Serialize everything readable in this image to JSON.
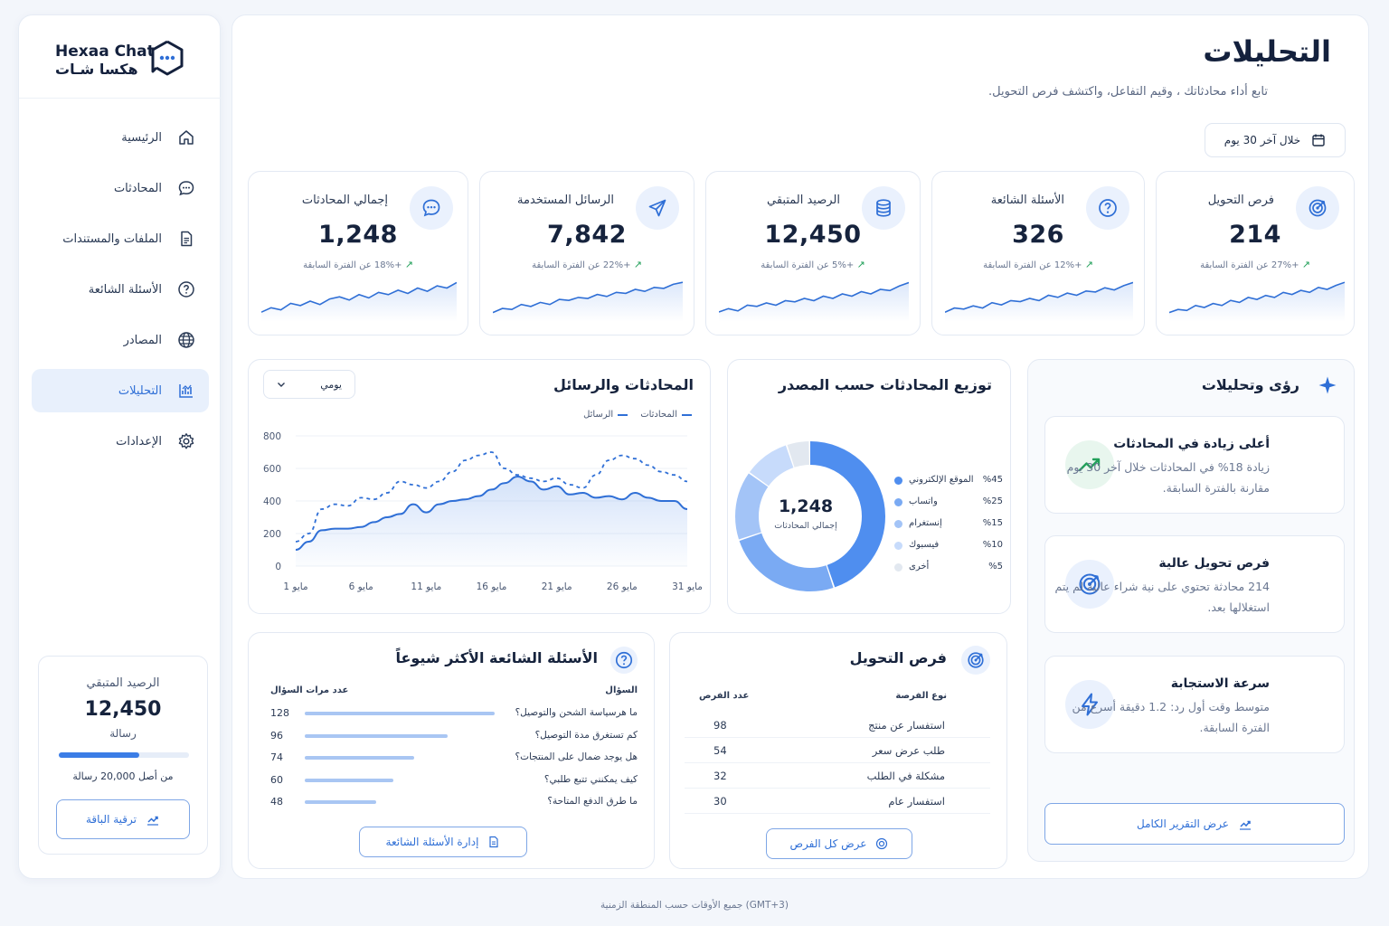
{
  "brand": {
    "name_en": "Hexaa Chat",
    "name_ar": "هكسا شـات"
  },
  "sidebar": {
    "items": [
      {
        "label": "الرئيسية",
        "icon": "home-icon"
      },
      {
        "label": "المحادثات",
        "icon": "chat-icon"
      },
      {
        "label": "الملفات والمستندات",
        "icon": "file-icon"
      },
      {
        "label": "الأسئلة الشائعة",
        "icon": "question-icon"
      },
      {
        "label": "المصادر",
        "icon": "globe-icon"
      },
      {
        "label": "التحليلات",
        "icon": "chart-icon",
        "active": true
      },
      {
        "label": "الإعدادات",
        "icon": "gear-icon"
      }
    ],
    "balance": {
      "title": "الرصيد المتبقي",
      "value": "12,450",
      "unit": "رسالة",
      "progress": 0.62,
      "of_text": "من أصل 20,000 رسالة",
      "upgrade_label": "ترقية الباقة"
    }
  },
  "header": {
    "title": "التحليلات",
    "subtitle": "تابع أداء محادثاتك ، وقيم التفاعل، واكتشف فرص التحويل.",
    "date_filter": "خلال آخر 30 يوم"
  },
  "kpis": [
    {
      "title": "إجمالي المحادثات",
      "value": "1,248",
      "change": "+18%",
      "suffix": "عن الفترة السابقة",
      "icon": "chat-bubble-icon",
      "spark": [
        30,
        34,
        32,
        38,
        36,
        40,
        37,
        42,
        44,
        41,
        46,
        43,
        48,
        46,
        50,
        47,
        52,
        49,
        54,
        52,
        57
      ]
    },
    {
      "title": "الرسائل المستخدمة",
      "value": "7,842",
      "change": "+22%",
      "suffix": "عن الفترة السابقة",
      "icon": "send-icon",
      "spark": [
        28,
        32,
        31,
        36,
        34,
        38,
        36,
        41,
        40,
        43,
        42,
        46,
        44,
        48,
        47,
        51,
        49,
        53,
        52,
        56,
        58
      ]
    },
    {
      "title": "الرصيد المتبقي",
      "value": "12,450",
      "change": "+5%",
      "suffix": "عن الفترة السابقة",
      "icon": "database-icon",
      "spark": [
        30,
        33,
        31,
        36,
        35,
        38,
        36,
        40,
        39,
        42,
        40,
        44,
        42,
        46,
        44,
        48,
        46,
        50,
        49,
        53,
        56
      ]
    },
    {
      "title": "الأسئلة الشائعة",
      "value": "326",
      "change": "+12%",
      "suffix": "عن الفترة السابقة",
      "icon": "question-circle-icon",
      "spark": [
        29,
        33,
        32,
        35,
        33,
        38,
        36,
        40,
        39,
        42,
        40,
        45,
        43,
        47,
        45,
        49,
        48,
        52,
        50,
        54,
        57
      ]
    },
    {
      "title": "فرص التحويل",
      "value": "214",
      "change": "+27%",
      "suffix": "عن الفترة السابقة",
      "icon": "target-icon",
      "spark": [
        28,
        31,
        30,
        35,
        33,
        37,
        35,
        40,
        38,
        43,
        41,
        45,
        43,
        48,
        46,
        50,
        48,
        53,
        51,
        55,
        58
      ]
    }
  ],
  "line_chart": {
    "title": "المحادثات والرسائل",
    "period": "يومي",
    "chart_data": {
      "type": "line",
      "x": [
        "1 مايو",
        "6 مايو",
        "11 مايو",
        "16 مايو",
        "21 مايو",
        "26 مايو",
        "31 مايو"
      ],
      "ylim": [
        0,
        800
      ],
      "yticks": [
        0,
        200,
        400,
        600,
        800
      ],
      "series": [
        {
          "name": "المحادثات",
          "style": "solid",
          "values": [
            100,
            150,
            220,
            230,
            230,
            240,
            270,
            300,
            320,
            380,
            330,
            380,
            400,
            410,
            430,
            470,
            510,
            550,
            520,
            470,
            490,
            440,
            450,
            420,
            430,
            410,
            450,
            420,
            400,
            400,
            350
          ]
        },
        {
          "name": "الرسائل",
          "style": "dashed",
          "values": [
            150,
            200,
            350,
            380,
            370,
            420,
            410,
            450,
            520,
            500,
            480,
            520,
            580,
            650,
            680,
            700,
            600,
            560,
            540,
            520,
            540,
            500,
            480,
            560,
            650,
            680,
            660,
            620,
            580,
            560,
            520
          ]
        }
      ]
    }
  },
  "donut": {
    "title": "توزيع المحادثات حسب المصدر",
    "center_value": "1,248",
    "center_label": "إجمالي المحادثات",
    "chart_data": {
      "type": "pie",
      "categories": [
        "الموقع الإلكتروني",
        "واتساب",
        "إنستغرام",
        "فيسبوك",
        "أخرى"
      ],
      "values": [
        45,
        25,
        15,
        10,
        5
      ],
      "labels": [
        "%45",
        "%25",
        "%15",
        "%10",
        "%5"
      ],
      "colors": [
        "#4f8eef",
        "#7aaaf3",
        "#a3c4f7",
        "#c7dbfb",
        "#e2e8f0"
      ]
    }
  },
  "insights": {
    "title": "رؤى وتحليلات",
    "items": [
      {
        "title": "أعلى زيادة في المحادثات",
        "desc": "زيادة 18% في المحادثات خلال آخر 30 يوم مقارنة بالفترة السابقة.",
        "icon": "trending-up-icon"
      },
      {
        "title": "فرص تحويل عالية",
        "desc": "214 محادثة تحتوي على نية شراء عالية لم يتم استغلالها بعد.",
        "icon": "target-icon"
      },
      {
        "title": "سرعة الاستجابة",
        "desc": "متوسط وقت أول رد: 1.2 دقيقة أسرع من الفترة السابقة.",
        "icon": "lightning-icon"
      }
    ],
    "button_label": "عرض التقرير الكامل"
  },
  "faq": {
    "title": "الأسئلة الشائعة الأكثر شيوعاً",
    "col_question": "السؤال",
    "col_count": "عدد مرات السؤال",
    "rows": [
      {
        "q": "ما هرسياسة الشحن والتوصيل؟",
        "count": 128
      },
      {
        "q": "كم تستغرق مدة التوصيل؟",
        "count": 96
      },
      {
        "q": "هل يوجد ضمال على المنتجات؟",
        "count": 74
      },
      {
        "q": "كيف يمكنني تتبع طلبي؟",
        "count": 60
      },
      {
        "q": "ما طرق الدفع المتاحة؟",
        "count": 48
      }
    ],
    "max": 128,
    "button_label": "إدارة الأسئلة الشائعة"
  },
  "conversion": {
    "title": "فرص التحويل",
    "col_type": "نوع الفرصة",
    "col_count": "عدد الفرص",
    "rows": [
      {
        "type": "استفسار عن منتج",
        "count": "98"
      },
      {
        "type": "طلب عرض سعر",
        "count": "54"
      },
      {
        "type": "مشكلة في الطلب",
        "count": "32"
      },
      {
        "type": "استفسار عام",
        "count": "30"
      }
    ],
    "button_label": "عرض كل الفرص"
  },
  "footer": "جميع الأوقات حسب المنطقة الزمنية (GMT+3)",
  "colors": {
    "accent": "#2f6fd6",
    "accent_light": "#eaf1fd",
    "positive": "#22a05a"
  }
}
